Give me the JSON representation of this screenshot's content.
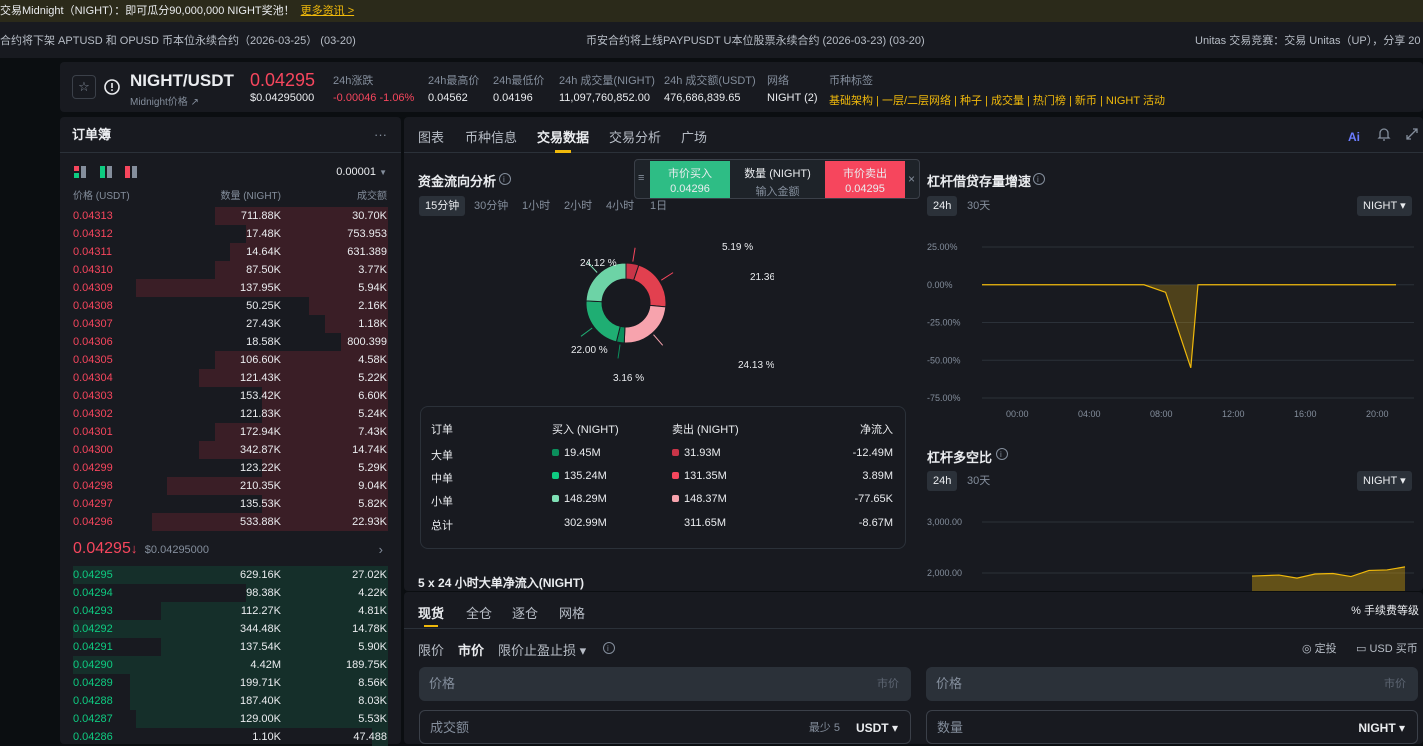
{
  "banner": {
    "text": "交易Midnight（NIGHT）：即可瓜分90,000,000 NIGHT奖池！",
    "link": "更多资讯 >"
  },
  "news": [
    "合约将下架 APTUSD 和 OPUSD 币本位永续合约（2026-03-25）  (03-20)",
    "币安合约将上线PAYPUSDT U本位股票永续合约 (2026-03-23) (03-20)",
    "Unitas 交易竞赛：交易 Unitas（UP），分享 20 万"
  ],
  "ticker": {
    "star": "☆",
    "pair": "NIGHT/USDT",
    "subtitle": "Midnight价格 ↗",
    "price": "0.04295",
    "price_usd": "$0.04295000",
    "stats": [
      {
        "label": "24h涨跌",
        "value": "-0.00046 -1.06%"
      },
      {
        "label": "24h最高价",
        "value": "0.04562"
      },
      {
        "label": "24h最低价",
        "value": "0.04196"
      },
      {
        "label": "24h 成交量(NIGHT)",
        "value": "11,097,760,852.00"
      },
      {
        "label": "24h 成交额(USDT)",
        "value": "476,686,839.65"
      },
      {
        "label": "网络",
        "value": "NIGHT (2)"
      },
      {
        "label": "币种标签",
        "value": "基础架构 | 一层/二层网络 | 种子 | 成交量 | 热门榜 | 新币 | NIGHT 活动"
      }
    ]
  },
  "orderbook": {
    "title": "订单簿",
    "more": "···",
    "precision": "0.00001",
    "headers": [
      "价格 (USDT)",
      "数量 (NIGHT)",
      "成交额"
    ],
    "asks": [
      [
        "0.04313",
        "711.88K",
        "30.70K"
      ],
      [
        "0.04312",
        "17.48K",
        "753.953"
      ],
      [
        "0.04311",
        "14.64K",
        "631.389"
      ],
      [
        "0.04310",
        "87.50K",
        "3.77K"
      ],
      [
        "0.04309",
        "137.95K",
        "5.94K"
      ],
      [
        "0.04308",
        "50.25K",
        "2.16K"
      ],
      [
        "0.04307",
        "27.43K",
        "1.18K"
      ],
      [
        "0.04306",
        "18.58K",
        "800.399"
      ],
      [
        "0.04305",
        "106.60K",
        "4.58K"
      ],
      [
        "0.04304",
        "121.43K",
        "5.22K"
      ],
      [
        "0.04303",
        "153.42K",
        "6.60K"
      ],
      [
        "0.04302",
        "121.83K",
        "5.24K"
      ],
      [
        "0.04301",
        "172.94K",
        "7.43K"
      ],
      [
        "0.04300",
        "342.87K",
        "14.74K"
      ],
      [
        "0.04299",
        "123.22K",
        "5.29K"
      ],
      [
        "0.04298",
        "210.35K",
        "9.04K"
      ],
      [
        "0.04297",
        "135.53K",
        "5.82K"
      ],
      [
        "0.04296",
        "533.88K",
        "22.93K"
      ]
    ],
    "ask_depth": [
      0.55,
      0.45,
      0.5,
      0.55,
      0.8,
      0.25,
      0.2,
      0.15,
      0.55,
      0.6,
      0.4,
      0.4,
      0.55,
      0.6,
      0.4,
      0.7,
      0.4,
      0.75
    ],
    "last_price": "0.04295",
    "last_arrow": "↓",
    "last_usd": "$0.04295000",
    "bids": [
      [
        "0.04295",
        "629.16K",
        "27.02K"
      ],
      [
        "0.04294",
        "98.38K",
        "4.22K"
      ],
      [
        "0.04293",
        "112.27K",
        "4.81K"
      ],
      [
        "0.04292",
        "344.48K",
        "14.78K"
      ],
      [
        "0.04291",
        "137.54K",
        "5.90K"
      ],
      [
        "0.04290",
        "4.42M",
        "189.75K"
      ],
      [
        "0.04289",
        "199.71K",
        "8.56K"
      ],
      [
        "0.04288",
        "187.40K",
        "8.03K"
      ],
      [
        "0.04287",
        "129.00K",
        "5.53K"
      ],
      [
        "0.04286",
        "1.10K",
        "47.488"
      ]
    ],
    "bid_depth": [
      1.0,
      0.45,
      0.72,
      1.0,
      0.72,
      1.0,
      0.82,
      0.82,
      0.8,
      0.05
    ]
  },
  "tabs": [
    "图表",
    "币种信息",
    "交易数据",
    "交易分析",
    "广场"
  ],
  "active_tab": "交易数据",
  "flow": {
    "title": "资金流向分析",
    "periods": [
      "15分钟",
      "30分钟",
      "1小时",
      "2小时",
      "4小时",
      "1日"
    ],
    "donut_labels": [
      "5.19 %",
      "21.36 %",
      "24.13 %",
      "3.16 %",
      "22.00 %",
      "24.12 %"
    ],
    "table_headers": [
      "订单",
      "买入 (NIGHT)",
      "卖出 (NIGHT)",
      "净流入"
    ],
    "rows": [
      {
        "name": "大单",
        "buy": "19.45M",
        "sell": "31.93M",
        "net": "-12.49M"
      },
      {
        "name": "中单",
        "buy": "135.24M",
        "sell": "131.35M",
        "net": "3.89M"
      },
      {
        "name": "小单",
        "buy": "148.29M",
        "sell": "148.37M",
        "net": "-77.65K"
      },
      {
        "name": "总计",
        "buy": "302.99M",
        "sell": "311.65M",
        "net": "-8.67M"
      }
    ],
    "five_title": "5 x 24 小时大单净流入(NIGHT)"
  },
  "floatbox": {
    "buy_label": "市价买入",
    "buy_price": "0.04296",
    "qty_label": "数量 (NIGHT)",
    "qty_placeholder": "输入金额",
    "sell_label": "市价卖出",
    "sell_price": "0.04295",
    "close": "×",
    "grip": "≡"
  },
  "colors": {
    "buy": "#0ecb81",
    "sell": "#f6465d",
    "accent": "#f0b90b",
    "bg": "#181a20"
  },
  "chart_data": [
    {
      "type": "pie",
      "title": "资金流向分析",
      "labels": [
        "大单卖出",
        "中单卖出",
        "小单卖出",
        "小单买入",
        "中单买入",
        "大单买入"
      ],
      "values": [
        5.19,
        21.36,
        24.13,
        3.16,
        22.0,
        24.12
      ]
    },
    {
      "type": "line",
      "title": "杠杆借贷存量增速",
      "periods": [
        "24h",
        "30天"
      ],
      "currency": "NIGHT",
      "x_ticks": [
        "00:00",
        "04:00",
        "08:00",
        "12:00",
        "16:00",
        "20:00"
      ],
      "y_ticks": [
        "25.00%",
        "0.00%",
        "-25.00%",
        "-50.00%",
        "-75.00%"
      ],
      "ylim": [
        -75,
        25
      ],
      "x": [
        0,
        9,
        10.2,
        11.6,
        12,
        23
      ],
      "y": [
        0,
        0,
        -5,
        -55,
        0,
        0
      ]
    },
    {
      "type": "area",
      "title": "杠杆多空比",
      "periods": [
        "24h",
        "30天"
      ],
      "currency": "NIGHT",
      "y_ticks": [
        "3,000.00",
        "2,000.00"
      ],
      "ylim": [
        1800,
        3200
      ],
      "x": [
        15,
        16.5,
        17.5,
        18.5,
        19.5,
        20.5,
        21.5,
        22.5,
        23.5
      ],
      "y": [
        1940,
        1960,
        1900,
        1980,
        1990,
        1930,
        2050,
        2060,
        2120
      ]
    }
  ],
  "lev_growth": {
    "title": "杠杆借贷存量增速",
    "p24": "24h",
    "p30": "30天",
    "ccy": "NIGHT ▾"
  },
  "lev_ratio": {
    "title": "杠杆多空比",
    "p24": "24h",
    "p30": "30天",
    "ccy": "NIGHT ▾"
  },
  "trade": {
    "tabs": [
      "现货",
      "全仓",
      "逐仓",
      "网格"
    ],
    "fee": "% 手续费等级",
    "order_types": [
      "限价",
      "市价",
      "限价止盈止损 ▾"
    ],
    "dca": "定投",
    "usd_buy": "USD 买币",
    "left": {
      "price_ph": "价格",
      "price_tag": "市价",
      "amount_ph": "成交额",
      "min": "最少 5",
      "unit": "USDT ▾"
    },
    "right": {
      "price_ph": "价格",
      "price_tag": "市价",
      "qty_ph": "数量",
      "unit": "NIGHT ▾"
    }
  }
}
